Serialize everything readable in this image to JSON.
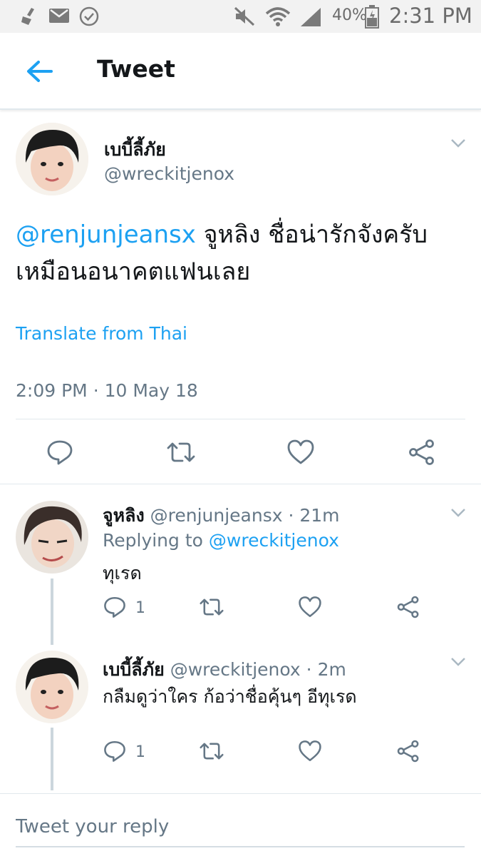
{
  "status_bar": {
    "battery_percent": "40%",
    "time": "2:31 PM",
    "icons": [
      "broom-icon",
      "mail-icon",
      "check-circle-icon",
      "mute-icon",
      "wifi-icon",
      "signal-icon",
      "battery-icon"
    ]
  },
  "header": {
    "title": "Tweet",
    "back_icon": "arrow-left-icon"
  },
  "main_tweet": {
    "display_name": "เบบี้ลี้ภัย",
    "handle": "@wreckitjenox",
    "mention": "@renjunjeansx",
    "text": " จูหลิง ชื่อน่ารักจังครับเหมือนอนาคตแฟนเลย",
    "translate_label": "Translate from Thai",
    "time": "2:09 PM",
    "separator": "·",
    "date": "10 May 18"
  },
  "replies": [
    {
      "display_name": "จูหลิง",
      "handle": "@renjunjeansx",
      "age": "· 21m",
      "replying_prefix": "Replying to ",
      "replying_handle": "@wreckitjenox",
      "text": "ทุเรด",
      "reply_count": "1"
    },
    {
      "display_name": "เบบี้ลี้ภัย",
      "handle": "@wreckitjenox",
      "age": "· 2m",
      "text": "กลืมดูว่าใคร ก้อว่าชื่อคุ้นๆ อีทุเรด",
      "reply_count": "1"
    }
  ],
  "compose": {
    "placeholder": "Tweet your reply"
  },
  "colors": {
    "accent": "#1da1f2",
    "text": "#14171a",
    "muted": "#657786",
    "divider": "#e1e8ed"
  }
}
